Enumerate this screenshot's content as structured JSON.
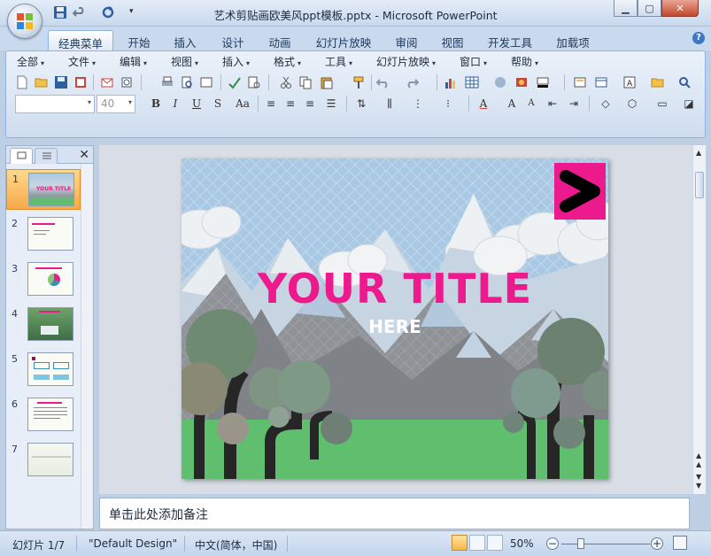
{
  "window": {
    "title": "艺术剪贴画欧美风ppt模板.pptx - Microsoft PowerPoint"
  },
  "ribbon_tabs": [
    {
      "label": "经典菜单",
      "active": true
    },
    {
      "label": "开始",
      "active": false
    },
    {
      "label": "插入",
      "active": false
    },
    {
      "label": "设计",
      "active": false
    },
    {
      "label": "动画",
      "active": false
    },
    {
      "label": "幻灯片放映",
      "active": false
    },
    {
      "label": "审阅",
      "active": false
    },
    {
      "label": "视图",
      "active": false
    },
    {
      "label": "开发工具",
      "active": false
    },
    {
      "label": "加载项",
      "active": false
    }
  ],
  "menu": [
    {
      "label": "全部"
    },
    {
      "label": "文件"
    },
    {
      "label": "编辑"
    },
    {
      "label": "视图"
    },
    {
      "label": "插入"
    },
    {
      "label": "格式"
    },
    {
      "label": "工具"
    },
    {
      "label": "幻灯片放映"
    },
    {
      "label": "窗口"
    },
    {
      "label": "帮助"
    }
  ],
  "format_bar": {
    "font_name": "",
    "font_size": "40"
  },
  "slides": [
    {
      "number": "1",
      "selected": true
    },
    {
      "number": "2",
      "selected": false
    },
    {
      "number": "3",
      "selected": false
    },
    {
      "number": "4",
      "selected": false
    },
    {
      "number": "5",
      "selected": false
    },
    {
      "number": "6",
      "selected": false
    },
    {
      "number": "7",
      "selected": false
    }
  ],
  "slide_content": {
    "title": "YOUR TITLE",
    "subtitle": "HERE"
  },
  "notes": {
    "placeholder": "单击此处添加备注"
  },
  "status": {
    "slide_counter": "幻灯片 1/7",
    "theme": "\"Default Design\"",
    "language": "中文(简体，中国)",
    "zoom": "50%"
  },
  "colors": {
    "title_pink": "#ec1a8c",
    "grass": "#5fbf6f",
    "sky": "#a9c9e3"
  }
}
